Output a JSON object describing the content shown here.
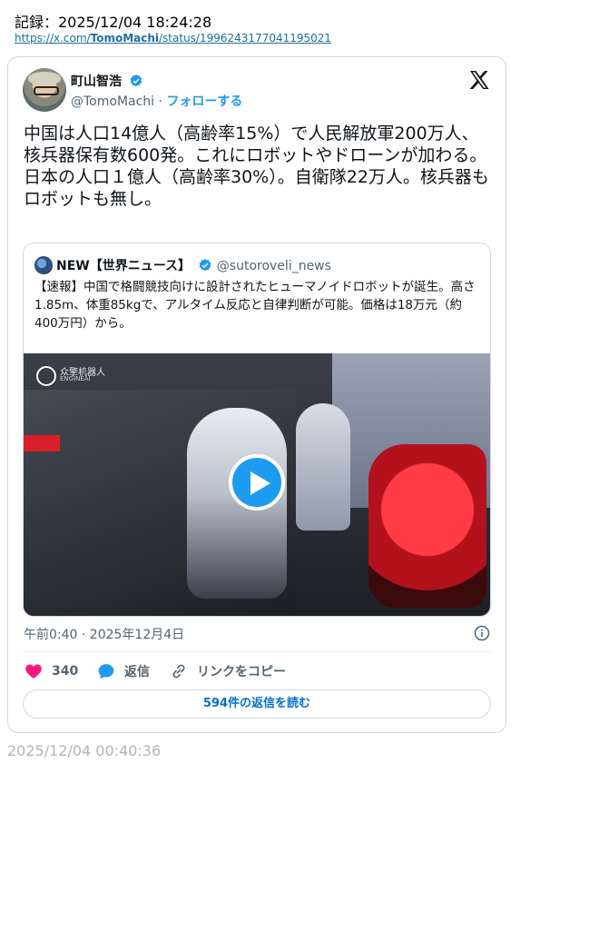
{
  "record_line": "記録：2025/12/04 18:24:28",
  "source_url": {
    "prefix": "https://x.com/",
    "user": "TomoMachi",
    "suffix": "/status/1996243177041195021"
  },
  "tweet": {
    "display_name": "町山智浩",
    "handle": "@TomoMachi",
    "separator": " · ",
    "follow_label": "フォローする",
    "text": "中国は人口14億人（高齢率15%）で人民解放軍200万人、核兵器保有数600発。これにロボットやドローンが加わる。\n日本の人口１億人（高齢率30%）。自衛隊22万人。核兵器もロボットも無し。",
    "timestamp": "午前0:40 · 2025年12月4日",
    "likes": "340",
    "reply_label": "返信",
    "copy_link_label": "リンクをコピー",
    "read_replies_label": "594件の返信を読む"
  },
  "quoted_tweet": {
    "display_name": "NEW【世界ニュース】",
    "handle": "@sutoroveli_news",
    "text": "【速報】中国で格闘競技向けに設計されたヒューマノイドロボットが誕生。高さ1.85m、体重85kgで、アルタイム反応と自律判断が可能。価格は18万元（約400万円）から。",
    "media_logo_text": "众擎机器人",
    "media_logo_sub": "ENGINEAI"
  },
  "footer_timestamp": "2025/12/04 00:40:36",
  "colors": {
    "accent": "#1d9bf0",
    "like": "#f91880",
    "text": "#0f1419",
    "muted": "#536471",
    "border": "#cfd9de"
  },
  "icons": [
    "verified-badge-icon",
    "x-logo-icon",
    "play-icon",
    "info-icon",
    "heart-icon",
    "reply-bubble-icon",
    "link-icon"
  ]
}
